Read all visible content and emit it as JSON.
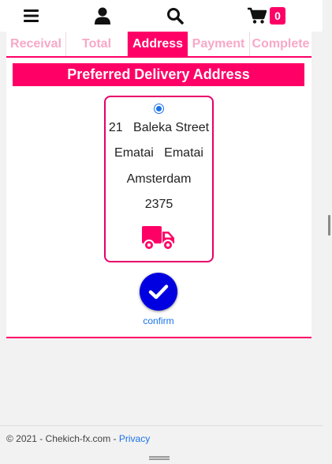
{
  "navbar": {
    "icons": [
      "menu-icon",
      "user-icon",
      "search-icon",
      "cart-icon"
    ],
    "cart_count": "0"
  },
  "steps": [
    {
      "label": "Receival",
      "active": false
    },
    {
      "label": "Total",
      "active": false
    },
    {
      "label": "Address",
      "active": true
    },
    {
      "label": "Payment",
      "active": false
    },
    {
      "label": "Complete",
      "active": false
    }
  ],
  "address_section": {
    "title": "Preferred Delivery Address",
    "lines": [
      "21   Baleka Street",
      "Ematai   Ematai",
      "Amsterdam",
      "2375"
    ],
    "selected": true
  },
  "confirm": {
    "label": "confirm"
  },
  "footer": {
    "copyright": "© 2021 - Chekich-fx.com - ",
    "privacy_link": "Privacy"
  },
  "colors": {
    "accent": "#ff0066",
    "confirm_button": "#0000e0",
    "link": "#1a73e8"
  }
}
